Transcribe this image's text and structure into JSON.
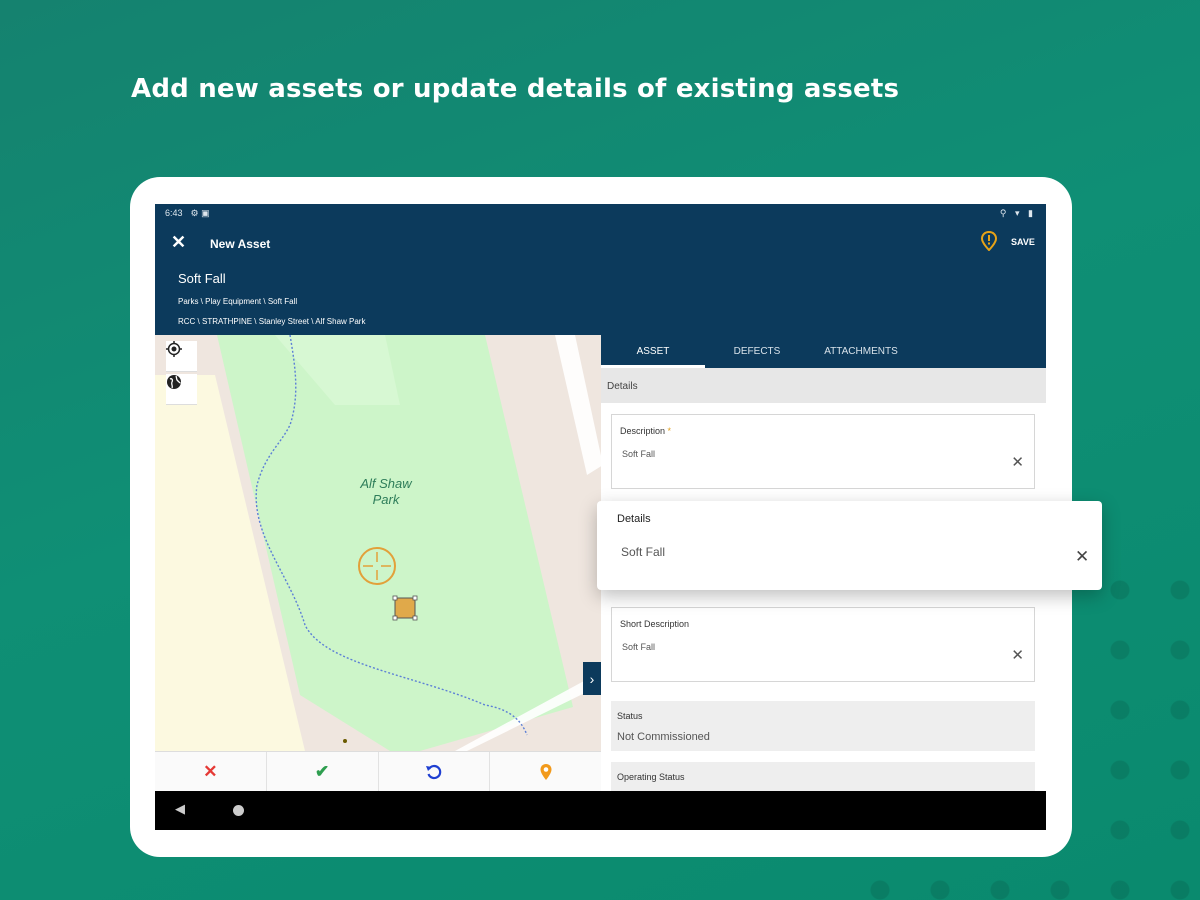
{
  "headline": "Add new assets or update details of existing assets",
  "colors": {
    "background": "#0f8f75",
    "app_bar": "#0c3a5c",
    "accent": "#e8a317"
  },
  "status_bar": {
    "time": "6:43",
    "left_icons": "⚙ ▣",
    "right_icons": "⚲ ▾ ▮"
  },
  "app_bar": {
    "close_icon": "close-icon",
    "title": "New Asset",
    "save_icon": "map-marker-warning-icon",
    "save_label": "SAVE",
    "asset_name": "Soft Fall",
    "category_path": "Parks \\ Play Equipment \\ Soft Fall",
    "location_path": "RCC \\ STRATHPINE \\ Stanley Street \\ Alf Shaw Park"
  },
  "map": {
    "park_name": "Alf Shaw Park",
    "tools": [
      "my-location-icon",
      "globe-icon"
    ],
    "toolbar": [
      "cancel-icon",
      "accept-icon",
      "undo-icon",
      "pin-icon"
    ]
  },
  "tabs": [
    "ASSET",
    "DEFECTS",
    "ATTACHMENTS"
  ],
  "details_section": "Details",
  "fields": {
    "description": {
      "label": "Description",
      "required_mark": "*",
      "value": "Soft Fall"
    },
    "short_description": {
      "label": "Short Description",
      "value": "Soft Fall"
    },
    "status": {
      "label": "Status",
      "value": "Not Commissioned"
    },
    "operating_status": {
      "label": "Operating Status"
    }
  },
  "popup": {
    "label": "Details",
    "value": "Soft Fall"
  }
}
